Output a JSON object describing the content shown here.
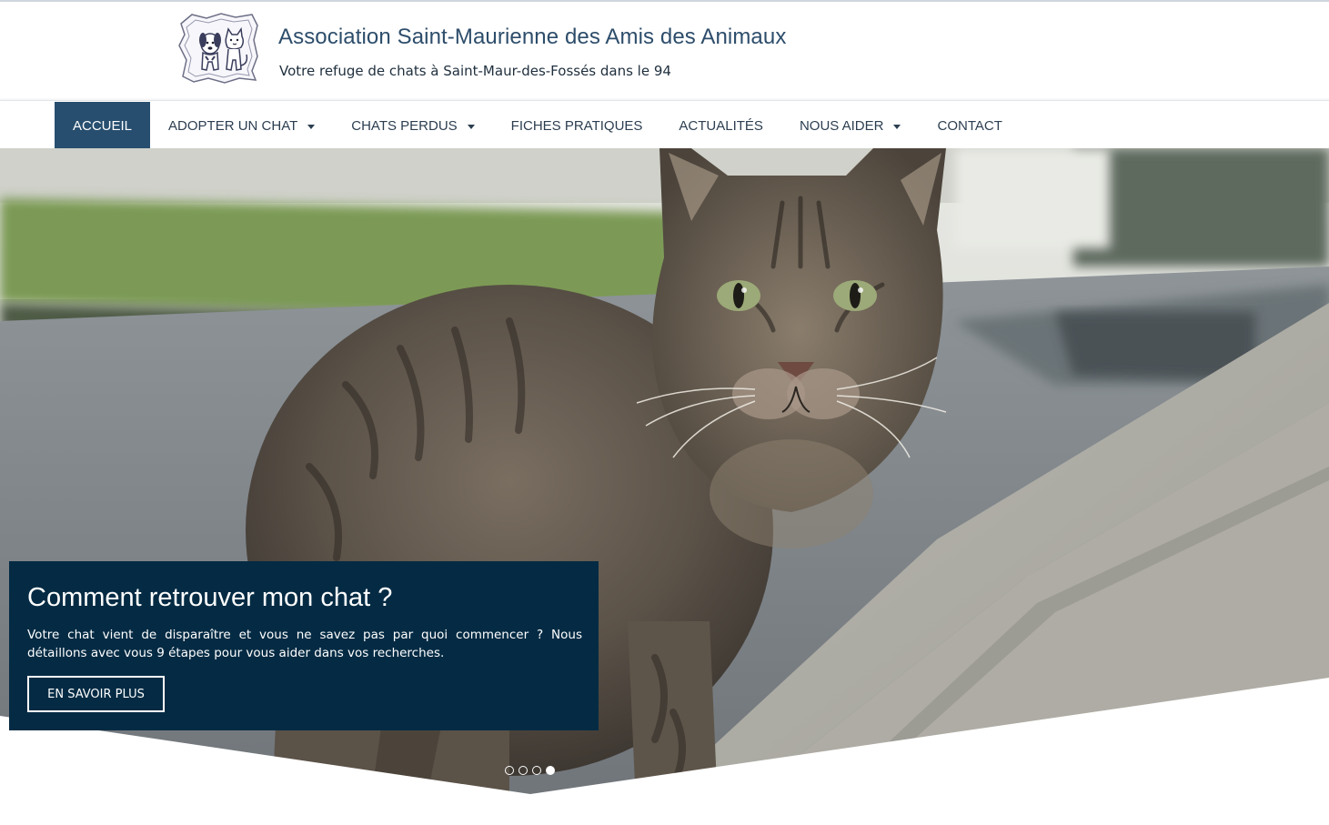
{
  "header": {
    "title": "Association Saint-Maurienne des Amis des Animaux",
    "tagline": "Votre refuge de chats à Saint-Maur-des-Fossés dans le 94",
    "logo_icon": "dog-and-cat-logo-icon"
  },
  "nav": {
    "items": [
      {
        "label": "ACCUEIL",
        "active": true,
        "dropdown": false
      },
      {
        "label": "ADOPTER UN CHAT",
        "active": false,
        "dropdown": true
      },
      {
        "label": "CHATS PERDUS",
        "active": false,
        "dropdown": true
      },
      {
        "label": "FICHES PRATIQUES",
        "active": false,
        "dropdown": false
      },
      {
        "label": "ACTUALITÉS",
        "active": false,
        "dropdown": false
      },
      {
        "label": "NOUS AIDER",
        "active": false,
        "dropdown": true
      },
      {
        "label": "CONTACT",
        "active": false,
        "dropdown": false
      }
    ]
  },
  "slider": {
    "caption_title": "Comment retrouver mon chat ?",
    "caption_text": "Votre chat vient de disparaître et vous ne savez pas par quoi commencer ? Nous détaillons avec vous 9 étapes pour vous aider dans vos recherches.",
    "button_label": "EN SAVOIR PLUS",
    "slide_count": 4,
    "active_slide": 4
  },
  "colors": {
    "nav_active": "#274e6e",
    "caption_bg": "#052b44",
    "title_text": "#2d4d6b"
  }
}
